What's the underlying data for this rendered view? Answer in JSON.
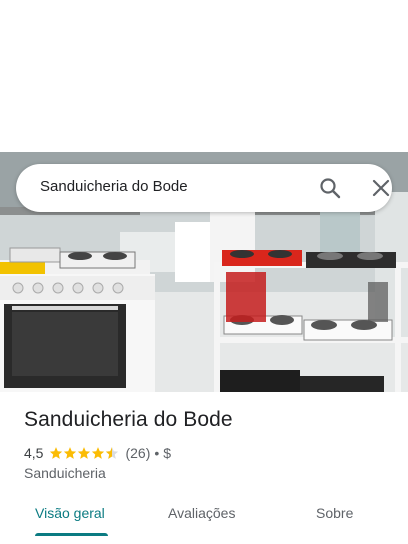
{
  "search": {
    "query": "Sanduicheria do Bode",
    "search_icon": "search-icon",
    "close_icon": "close-icon"
  },
  "photo": {
    "description_icon": "store-photo"
  },
  "place": {
    "name": "Sanduicheria do Bode",
    "rating": "4,5",
    "stars": 4.5,
    "reviews": "(26)",
    "separator": "•",
    "price": "$",
    "category": "Sanduicheria"
  },
  "tabs": [
    {
      "label": "Visão geral",
      "active": true
    },
    {
      "label": "Avaliações",
      "active": false
    },
    {
      "label": "Sobre",
      "active": false
    }
  ],
  "colors": {
    "accent": "#0b7b82",
    "star": "#fbbc04"
  }
}
